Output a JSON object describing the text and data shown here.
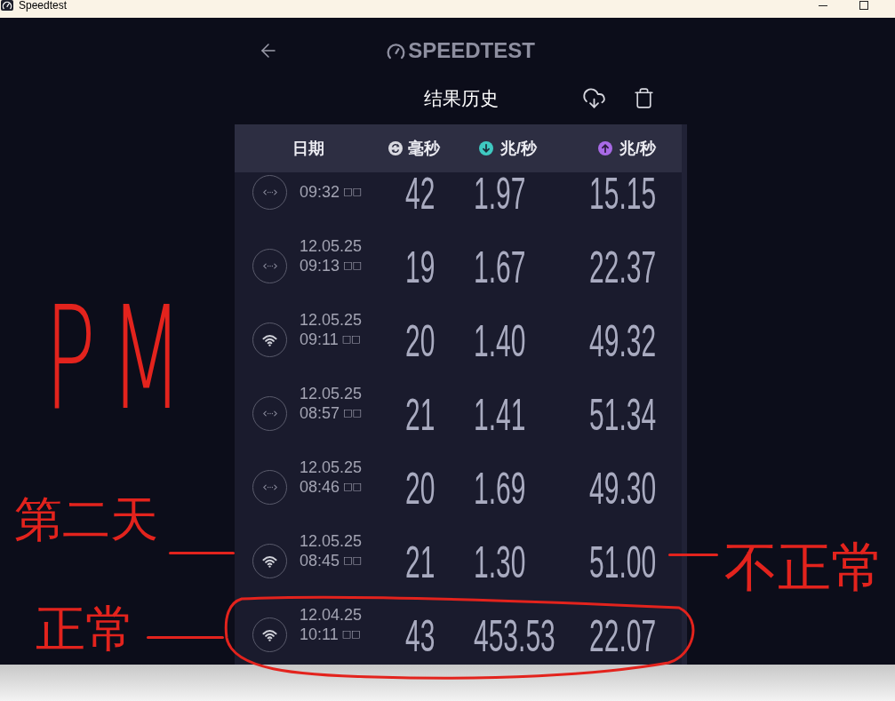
{
  "window": {
    "title": "Speedtest"
  },
  "app": {
    "logo": "SPEEDTEST",
    "title": "结果历史"
  },
  "table": {
    "columns": [
      {
        "kind": "date",
        "label": "日期"
      },
      {
        "kind": "ping",
        "label": "毫秒",
        "color": "#d9d9e0"
      },
      {
        "kind": "download",
        "label": "兆/秒",
        "color": "#3fc9c1"
      },
      {
        "kind": "upload",
        "label": "兆/秒",
        "color": "#a86ae6"
      }
    ],
    "rows": [
      {
        "kind": "wired",
        "time": "09:32",
        "meridiem": "□□",
        "ping": "42",
        "download": "1.97",
        "upload": "15.15",
        "circled": false
      },
      {
        "kind": "wired",
        "date": "12.05.25",
        "time": "09:13",
        "meridiem": "□□",
        "ping": "19",
        "download": "1.67",
        "upload": "22.37",
        "circled": false
      },
      {
        "kind": "wifi",
        "date": "12.05.25",
        "time": "09:11",
        "meridiem": "□□",
        "ping": "20",
        "download": "1.40",
        "upload": "49.32",
        "circled": false
      },
      {
        "kind": "wired",
        "date": "12.05.25",
        "time": "08:57",
        "meridiem": "□□",
        "ping": "21",
        "download": "1.41",
        "upload": "51.34",
        "circled": false
      },
      {
        "kind": "wired",
        "date": "12.05.25",
        "time": "08:46",
        "meridiem": "□□",
        "ping": "20",
        "download": "1.69",
        "upload": "49.30",
        "circled": false
      },
      {
        "kind": "wifi",
        "date": "12.05.25",
        "time": "08:45",
        "meridiem": "□□",
        "ping": "21",
        "download": "1.30",
        "upload": "51.00",
        "circled": false
      },
      {
        "kind": "wifi",
        "date": "12.04.25",
        "time": "10:11",
        "meridiem": "□□",
        "ping": "43",
        "download": "453.53",
        "upload": "22.07",
        "circled": true
      }
    ]
  },
  "annotations": [
    {
      "kind": "note",
      "text": "PM"
    },
    {
      "kind": "pointer",
      "text": "第二天"
    },
    {
      "kind": "pointer",
      "text": "正常"
    },
    {
      "kind": "pointer",
      "text": "不正常"
    }
  ]
}
